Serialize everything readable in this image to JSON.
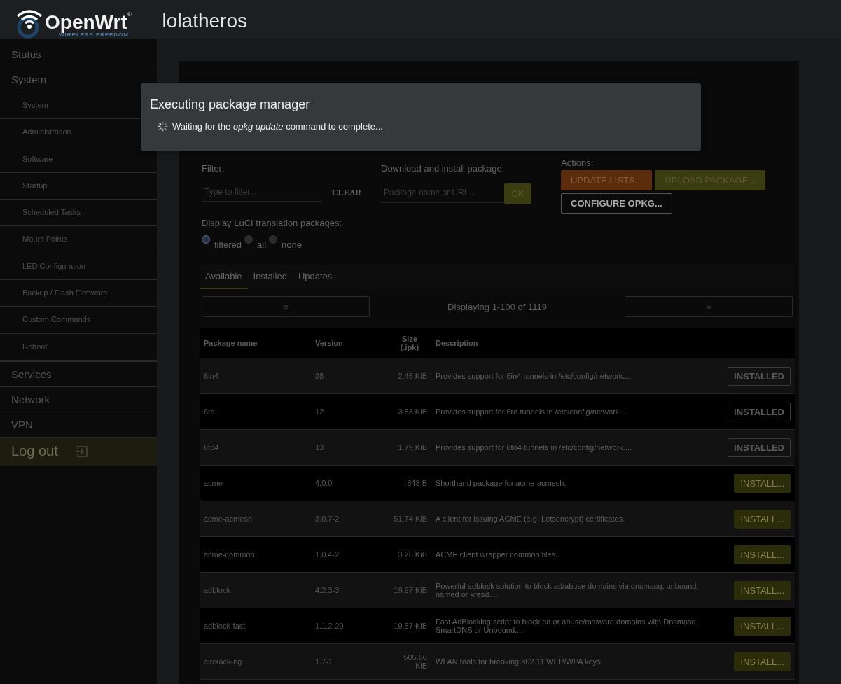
{
  "header": {
    "logo_text": "OpenWrt$^{®}$",
    "logo_tagline": "WIRELESS FREEDOM",
    "hostname": "lolatheros"
  },
  "sidebar": {
    "items": [
      {
        "label": "Status"
      },
      {
        "label": "System",
        "children": [
          {
            "label": "System"
          },
          {
            "label": "Administration"
          },
          {
            "label": "Software"
          },
          {
            "label": "Startup"
          },
          {
            "label": "Scheduled Tasks"
          },
          {
            "label": "Mount Points"
          },
          {
            "label": "LED Configuration"
          },
          {
            "label": "Backup / Flash Firmware"
          },
          {
            "label": "Custom Commands"
          },
          {
            "label": "Reboot"
          }
        ]
      },
      {
        "label": "Services"
      },
      {
        "label": "Network"
      },
      {
        "label": "VPN"
      }
    ],
    "logout": "Log out"
  },
  "modal": {
    "title": "Executing package manager",
    "message": "Waiting for the *opkg update* command to complete..."
  },
  "filter": {
    "label": "Filter:",
    "placeholder": "Type to filter...",
    "clear": "CLEAR"
  },
  "download": {
    "label": "Download and install package:",
    "placeholder": "Package name or URL...",
    "ok": "OK"
  },
  "actions": {
    "label": "Actions:",
    "buttons": [
      {
        "label": "UPDATE LISTS...",
        "kind": "warning"
      },
      {
        "label": "UPLOAD PACKAGE...",
        "kind": "positive"
      },
      {
        "label": "CONFIGURE OPKG...",
        "kind": "neutral"
      }
    ]
  },
  "translations": {
    "label": "Display LuCI translation packages:",
    "options": [
      {
        "label": "filtered",
        "selected": true
      },
      {
        "label": "all",
        "selected": false
      },
      {
        "label": "none",
        "selected": false
      }
    ]
  },
  "tabs": [
    {
      "label": "Available",
      "selected": true
    },
    {
      "label": "Installed",
      "selected": false
    },
    {
      "label": "Updates",
      "selected": false
    }
  ],
  "pager": {
    "prev": "«",
    "status": "Displaying 1-100 of 1119",
    "next": "»"
  },
  "table": {
    "columns": [
      "Package name",
      "Version",
      "Size (.ipk)",
      "Description"
    ],
    "rows": [
      {
        "name": "6in4",
        "version": "28",
        "size": "2.45 KiB",
        "description": "Provides support for 6in4 tunnels in /etc/config/network....",
        "action": {
          "label": "INSTALLED",
          "kind": "installed"
        }
      },
      {
        "name": "6rd",
        "version": "12",
        "size": "3.53 KiB",
        "description": "Provides support for 6rd tunnels in /etc/config/network....",
        "action": {
          "label": "INSTALLED",
          "kind": "installed"
        }
      },
      {
        "name": "6to4",
        "version": "13",
        "size": "1.79 KiB",
        "description": "Provides support for 6to4 tunnels in /etc/config/network....",
        "action": {
          "label": "INSTALLED",
          "kind": "installed"
        }
      },
      {
        "name": "acme",
        "version": "4.0.0",
        "size": "843 B",
        "description": "Shorthand package for acme-acmesh.",
        "action": {
          "label": "INSTALL...",
          "kind": "install"
        }
      },
      {
        "name": "acme-acmesh",
        "version": "3.0.7-2",
        "size": "51.74 KiB",
        "description": "A client for issuing ACME (e.g, Letsencrypt) certificates.",
        "action": {
          "label": "INSTALL...",
          "kind": "install"
        }
      },
      {
        "name": "acme-common",
        "version": "1.0.4-2",
        "size": "3.26 KiB",
        "description": "ACME client wrapper common files.",
        "action": {
          "label": "INSTALL...",
          "kind": "install"
        }
      },
      {
        "name": "adblock",
        "version": "4.2.3-3",
        "size": "19.97 KiB",
        "description": "Powerful adblock solution to block ad/abuse domains via dnsmasq, unbound, named or kresd....",
        "action": {
          "label": "INSTALL...",
          "kind": "install"
        }
      },
      {
        "name": "adblock-fast",
        "version": "1.1.2-20",
        "size": "19.57 KiB",
        "description": "Fast AdBlocking script to block ad or abuse/malware domains with Dnsmasq, SmartDNS or Unbound....",
        "action": {
          "label": "INSTALL...",
          "kind": "install"
        }
      },
      {
        "name": "aircrack-ng",
        "version": "1.7-1",
        "size": "505.60 KiB",
        "description": "WLAN tools for breaking 802.11 WEP/WPA keys",
        "action": {
          "label": "INSTALL...",
          "kind": "install"
        }
      }
    ]
  }
}
